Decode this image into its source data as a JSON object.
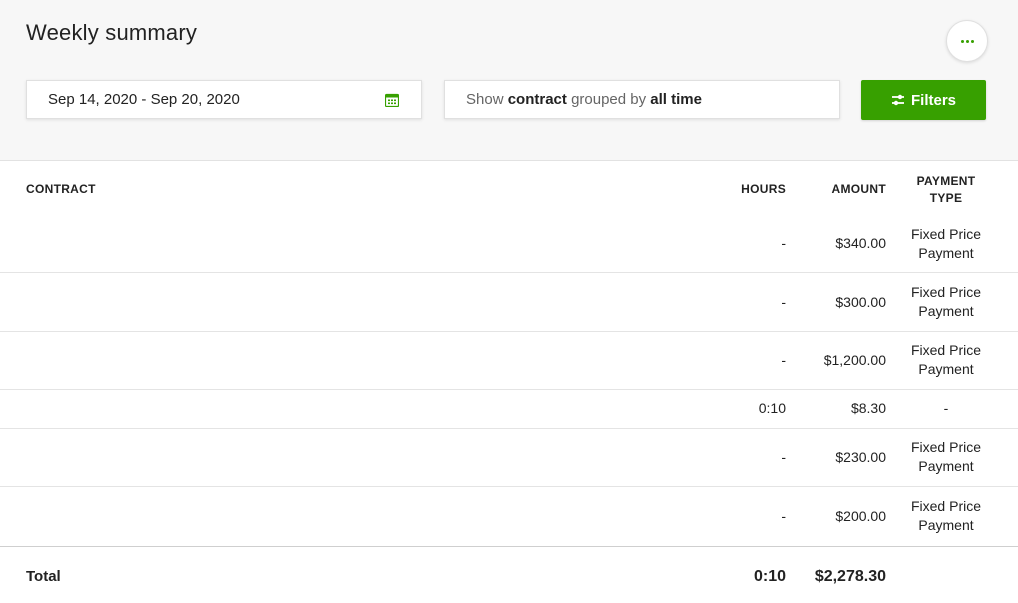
{
  "header": {
    "title": "Weekly summary",
    "date_range": "Sep 14, 2020 - Sep 20, 2020",
    "group_show": "Show",
    "group_field": "contract",
    "group_by": "grouped by",
    "group_period": "all time",
    "filters_label": "Filters",
    "more_icon": "more-dots-icon",
    "calendar_icon": "calendar-icon",
    "filters_icon": "sliders-icon"
  },
  "colors": {
    "accent": "#37a000"
  },
  "table": {
    "columns": {
      "contract": "CONTRACT",
      "hours": "HOURS",
      "amount": "AMOUNT",
      "payment_type_1": "PAYMENT",
      "payment_type_2": "TYPE"
    },
    "rows": [
      {
        "contract": "",
        "hours": "-",
        "amount": "$340.00",
        "payment_1": "Fixed Price",
        "payment_2": "Payment"
      },
      {
        "contract": "",
        "hours": "-",
        "amount": "$300.00",
        "payment_1": "Fixed Price",
        "payment_2": "Payment"
      },
      {
        "contract": "",
        "hours": "-",
        "amount": "$1,200.00",
        "payment_1": "Fixed Price",
        "payment_2": "Payment"
      },
      {
        "contract": "",
        "hours": "0:10",
        "amount": "$8.30",
        "payment_1": "-",
        "payment_2": ""
      },
      {
        "contract": "",
        "hours": "-",
        "amount": "$230.00",
        "payment_1": "Fixed Price",
        "payment_2": "Payment"
      },
      {
        "contract": "",
        "hours": "-",
        "amount": "$200.00",
        "payment_1": "Fixed Price",
        "payment_2": "Payment"
      }
    ],
    "total": {
      "label": "Total",
      "hours": "0:10",
      "amount": "$2,278.30"
    }
  }
}
